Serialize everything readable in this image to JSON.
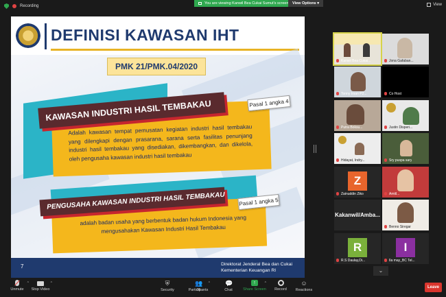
{
  "topbar": {
    "recording_label": "Recording",
    "viewing_label": "You are viewing Kanwil Bea Cukai Sumut's screen",
    "view_options_label": "View Options",
    "view_label": "View"
  },
  "slide": {
    "title": "DEFINISI KAWASAN IHT",
    "pmk": "PMK 21/PMK.04/2020",
    "section1": {
      "heading": "KAWASAN INDUSTRI HASIL TEMBAKAU",
      "tag": "Pasal 1 angka 4",
      "text": "Adalah kawasan tempat pemusatan kegiatan industri hasil tembakau yang dilengkapi dengan prasarana, sarana serta fasilitas penunjang industri hasil tembakau yang disediakan, dikembangkan, dan dikelola, oleh pengusaha kawasan industri hasil tembakau"
    },
    "section2": {
      "heading": "PENGUSAHA KAWASAN INDUSTRI HASIL TEMBAKAU",
      "tag": "Pasal 1 angka 5",
      "text": "adalah badan usaha yang berbentuk badan hukum Indonesia yang mengusahakan Kawasan Industri Hasil Tembakau"
    },
    "page_number": "7",
    "footer_line1": "Direktorat Jenderal Bea dan Cukai",
    "footer_line2": "Kementerian Keuangan RI"
  },
  "gallery": {
    "participants": [
      {
        "name": "Kanwil Bea Cukai..."
      },
      {
        "name": "Jona Gafaban..."
      },
      {
        "name": "Tonny Irsan P2..."
      },
      {
        "name": "Co Host"
      },
      {
        "name": "Putra Boksu..."
      },
      {
        "name": "Justin Disperi..."
      },
      {
        "name": "Hidayat, Indry..."
      },
      {
        "name": "Sry puspa sary"
      },
      {
        "name": "Zainuddin Ziko",
        "initial": "Z"
      },
      {
        "name": "Amitl..."
      },
      {
        "name": "Kakanwil/Amba..."
      },
      {
        "name": "Benno Siregar"
      },
      {
        "name": "R.S Daulay,Di...",
        "initial": "R"
      },
      {
        "name": "Ila may_BC Tel...",
        "initial": "I"
      }
    ]
  },
  "toolbar": {
    "unmute": "Unmute",
    "stop_video": "Stop Video",
    "security": "Security",
    "participants": "Participants",
    "participants_count": "26",
    "chat": "Chat",
    "share_screen": "Share Screen",
    "record": "Record",
    "reactions": "Reactions",
    "leave": "Leave"
  },
  "colors": {
    "share_green": "#2fa84f",
    "leave_red": "#d9352d",
    "slide_navy": "#1f3a6e",
    "slide_yellow": "#f4b71c",
    "slide_teal": "#2bb4c7"
  }
}
